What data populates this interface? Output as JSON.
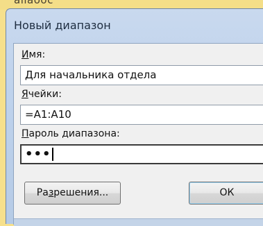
{
  "page_above": {
    "text": "ailaooc"
  },
  "dialog": {
    "title": "Новый диапазон",
    "name_label": "Имя:",
    "name_label_accesskey": "И",
    "name_label_rest": "мя:",
    "name_value": "Для начальника отдела",
    "cells_label_accesskey": "Я",
    "cells_label_rest": "чейки:",
    "cells_value": "=A1:A10",
    "password_label_accesskey": "П",
    "password_label_rest": "ароль диапазона:",
    "password_value": "•••",
    "permissions_button_pre": "Ра",
    "permissions_button_accesskey": "з",
    "permissions_button_post": "решения...",
    "ok_button": "ОК"
  },
  "colors": {
    "page_background": "#f6e08c",
    "title_bar": "#c9d9ee",
    "panel": "#f0f0f0",
    "ok_focus_ring": "#9ad4f5"
  }
}
